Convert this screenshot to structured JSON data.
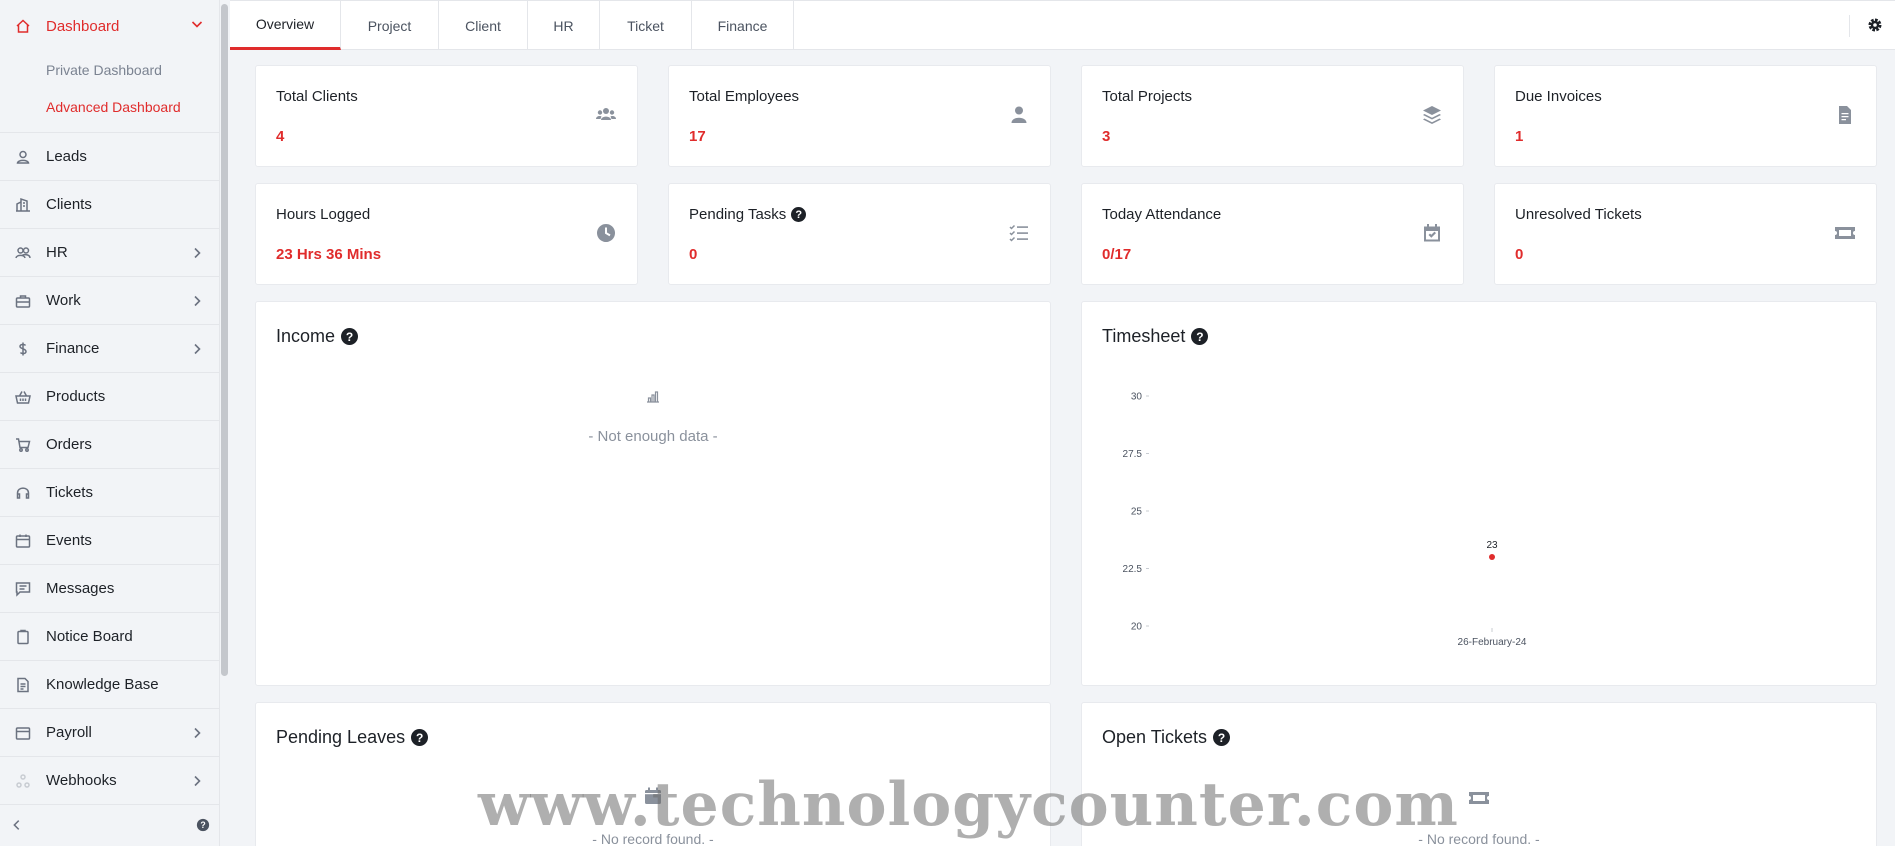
{
  "sidebar": {
    "items": [
      {
        "label": "Dashboard",
        "icon": "home-icon"
      },
      {
        "label": "Leads",
        "icon": "user-icon"
      },
      {
        "label": "Clients",
        "icon": "building-icon"
      },
      {
        "label": "HR",
        "icon": "users-icon"
      },
      {
        "label": "Work",
        "icon": "briefcase-icon"
      },
      {
        "label": "Finance",
        "icon": "dollar-icon"
      },
      {
        "label": "Products",
        "icon": "basket-icon"
      },
      {
        "label": "Orders",
        "icon": "cart-icon"
      },
      {
        "label": "Tickets",
        "icon": "headset-icon"
      },
      {
        "label": "Events",
        "icon": "calendar-icon"
      },
      {
        "label": "Messages",
        "icon": "message-icon"
      },
      {
        "label": "Notice Board",
        "icon": "clipboard-icon"
      },
      {
        "label": "Knowledge Base",
        "icon": "document-icon"
      },
      {
        "label": "Payroll",
        "icon": "wallet-icon"
      },
      {
        "label": "Webhooks",
        "icon": "webhook-icon"
      }
    ],
    "submenu": [
      "Private Dashboard",
      "Advanced Dashboard"
    ]
  },
  "tabs": [
    "Overview",
    "Project",
    "Client",
    "HR",
    "Ticket",
    "Finance"
  ],
  "stats": [
    {
      "label": "Total Clients",
      "value": "4",
      "icon": "users-icon"
    },
    {
      "label": "Total Employees",
      "value": "17",
      "icon": "user-icon"
    },
    {
      "label": "Total Projects",
      "value": "3",
      "icon": "layers-icon"
    },
    {
      "label": "Due Invoices",
      "value": "1",
      "icon": "invoice-icon"
    },
    {
      "label": "Hours Logged",
      "value": "23 Hrs 36 Mins",
      "icon": "clock-icon"
    },
    {
      "label": "Pending Tasks",
      "value": "0",
      "icon": "tasks-icon"
    },
    {
      "label": "Today Attendance",
      "value": "0/17",
      "icon": "calendar-check-icon"
    },
    {
      "label": "Unresolved Tickets",
      "value": "0",
      "icon": "ticket-icon"
    }
  ],
  "panels": {
    "income": {
      "title": "Income",
      "empty_text": "- Not enough data -"
    },
    "timesheet": {
      "title": "Timesheet"
    },
    "pending_leaves": {
      "title": "Pending Leaves",
      "empty_text": "- No record found. -"
    },
    "open_tickets": {
      "title": "Open Tickets",
      "empty_text": "- No record found. -"
    }
  },
  "chart_data": {
    "type": "scatter",
    "title": "Timesheet",
    "x": [
      "26-February-24"
    ],
    "y": [
      23
    ],
    "data_labels": [
      "23"
    ],
    "yticks": [
      "30",
      "27.5",
      "25",
      "22.5",
      "20"
    ],
    "ylim": [
      20,
      30
    ],
    "grid": false,
    "point_color": "#e02c2c"
  },
  "watermark": "www.technologycounter.com",
  "colors": {
    "accent": "#e02c2c",
    "text": "#1d2127",
    "muted": "#8a919c"
  }
}
